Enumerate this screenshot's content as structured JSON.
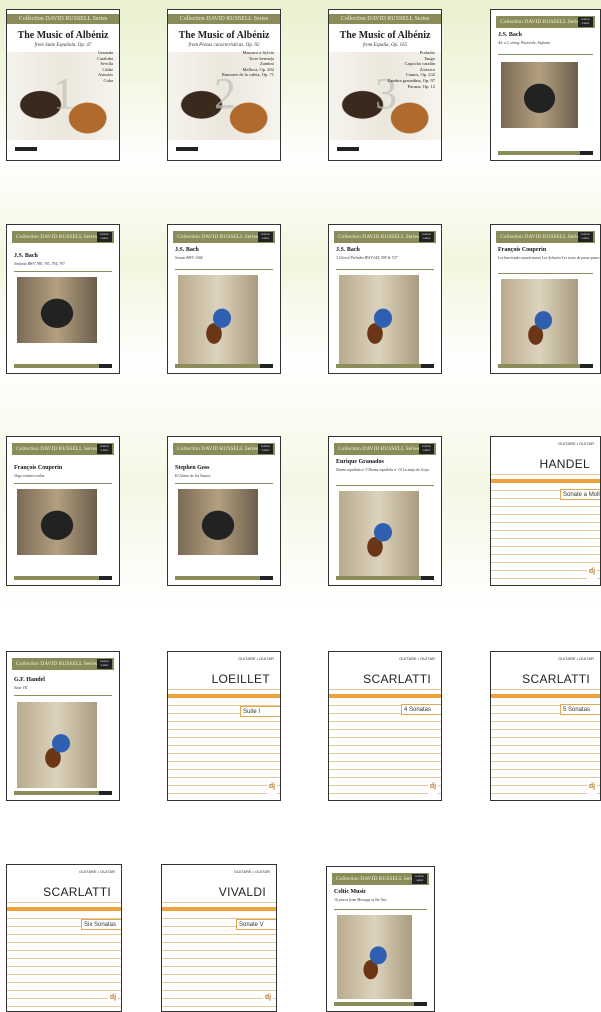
{
  "series_label": "Collection DAVID RUSSELL Series",
  "badge": "Guitare Guitar",
  "albeniz": [
    {
      "title": "The Music of Albéniz",
      "subtitle": "from Suite Española, Op. 47",
      "num": "1",
      "pieces": [
        "Granada",
        "Cataluña",
        "Sevilla",
        "Cádiz",
        "Asturias",
        "Cuba"
      ]
    },
    {
      "title": "The Music of Albéniz",
      "subtitle": "from Piezas características, Op. 92",
      "num": "2",
      "pieces": [
        "Mazurca a Sylvia",
        "Torre bermeja",
        "Zambra",
        "",
        "Malloca, Op. 202",
        "Rumores de la caleta, Op. 71"
      ]
    },
    {
      "title": "The Music of Albéniz",
      "subtitle": "from España, Op. 165",
      "num": "3",
      "pieces": [
        "Preludio",
        "Tango",
        "Capricho catalán",
        "Zortzico",
        "",
        "Cantos, Op. 232",
        "Zambra granadina, Op. 97",
        "Pavana, Op. 12"
      ]
    }
  ],
  "russell": [
    {
      "composer": "J.S. Bach",
      "work": "Air a C string, Pastorale, Sinfonia",
      "pic": "dark"
    },
    {
      "composer": "J.S. Bach",
      "work": "Sinfonia BWV 788, 793, 794, 797",
      "pic": "dark"
    },
    {
      "composer": "J.S. Bach",
      "work": "Sonate BWV 1004",
      "pic": "stand"
    },
    {
      "composer": "J.S. Bach",
      "work": "3 Choral Preludes BWV 645, 599 & 727",
      "pic": "stand"
    },
    {
      "composer": "François Couperin",
      "work": "Les barricades mystérieuses Les Sylvains Les tours de passe-passe",
      "pic": "stand"
    },
    {
      "composer": "François Couperin",
      "work": "Virgo sinistra trahis",
      "pic": "dark"
    },
    {
      "composer": "Stephen Goss",
      "work": "El Llanto de los Sauces",
      "pic": "dark"
    },
    {
      "composer": "Enrique Granados",
      "work": "Danza española nº 5 Danza española nº 10 La maja de Goya",
      "pic": "stand"
    },
    {
      "composer": "G.F. Handel",
      "work": "Suite VII",
      "pic": "stand"
    },
    {
      "composer": "Celtic Music",
      "work": "16 pieces from Message of the Sea",
      "pic": "stand"
    }
  ],
  "lined": [
    {
      "top": "GUITARE • GUITAR",
      "name": "HANDEL",
      "box": "Sonate a Moll"
    },
    {
      "top": "GUITARE • GUITAR",
      "name": "LOEILLET",
      "box": "Suite I"
    },
    {
      "top": "GUITARE • GUITAR",
      "name": "SCARLATTI",
      "box": "4 Sonatas"
    },
    {
      "top": "GUITARE • GUITAR",
      "name": "SCARLATTI",
      "box": "5 Sonatas"
    },
    {
      "top": "GUITARE • GUITAR",
      "name": "SCARLATTI",
      "box": "Six Sonatas"
    },
    {
      "top": "GUITARE • GUITAR",
      "name": "VIVALDI",
      "box": "Sonate V"
    }
  ]
}
